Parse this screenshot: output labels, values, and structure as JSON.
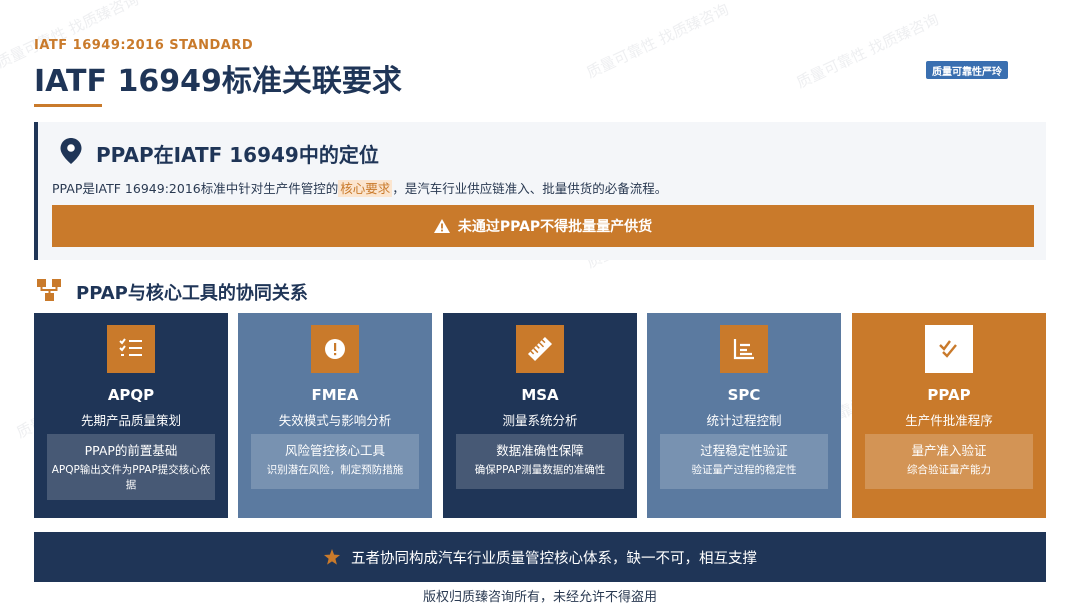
{
  "header": {
    "eyebrow": "IATF 16949:2016 STANDARD",
    "title": "IATF 16949标准关联要求",
    "logo_text": "质量可靠性严玲"
  },
  "position_panel": {
    "title": "PPAP在IATF 16949中的定位",
    "text_before": "PPAP是IATF 16949:2016标准中针对生产件管控的",
    "highlight": "核心要求",
    "text_after": "，是汽车行业供应链准入、批量供货的必备流程。",
    "warning": "未通过PPAP不得批量量产供货"
  },
  "synergy_section": {
    "title": "PPAP与核心工具的协同关系"
  },
  "cards": [
    {
      "name": "APQP",
      "subtitle": "先期产品质量策划",
      "box_title": "PPAP的前置基础",
      "box_desc": "APQP输出文件为PPAP提交核心依据",
      "icon": "checklist-icon"
    },
    {
      "name": "FMEA",
      "subtitle": "失效模式与影响分析",
      "box_title": "风险管控核心工具",
      "box_desc": "识别潜在风险，制定预防措施",
      "icon": "alert-circle-icon"
    },
    {
      "name": "MSA",
      "subtitle": "测量系统分析",
      "box_title": "数据准确性保障",
      "box_desc": "确保PPAP测量数据的准确性",
      "icon": "ruler-icon"
    },
    {
      "name": "SPC",
      "subtitle": "统计过程控制",
      "box_title": "过程稳定性验证",
      "box_desc": "验证量产过程的稳定性",
      "icon": "chart-icon"
    },
    {
      "name": "PPAP",
      "subtitle": "生产件批准程序",
      "box_title": "量产准入验证",
      "box_desc": "综合验证量产能力",
      "icon": "check-double-icon"
    }
  ],
  "footer": {
    "summary": "五者协同构成汽车行业质量管控核心体系，缺一不可，相互支撑",
    "copyright": "版权归质臻咨询所有，未经允许不得盗用"
  },
  "watermark": "质量可靠性 找质臻咨询",
  "colors": {
    "navy": "#1f3557",
    "steel": "#5b7aa0",
    "orange": "#c97a2b"
  }
}
